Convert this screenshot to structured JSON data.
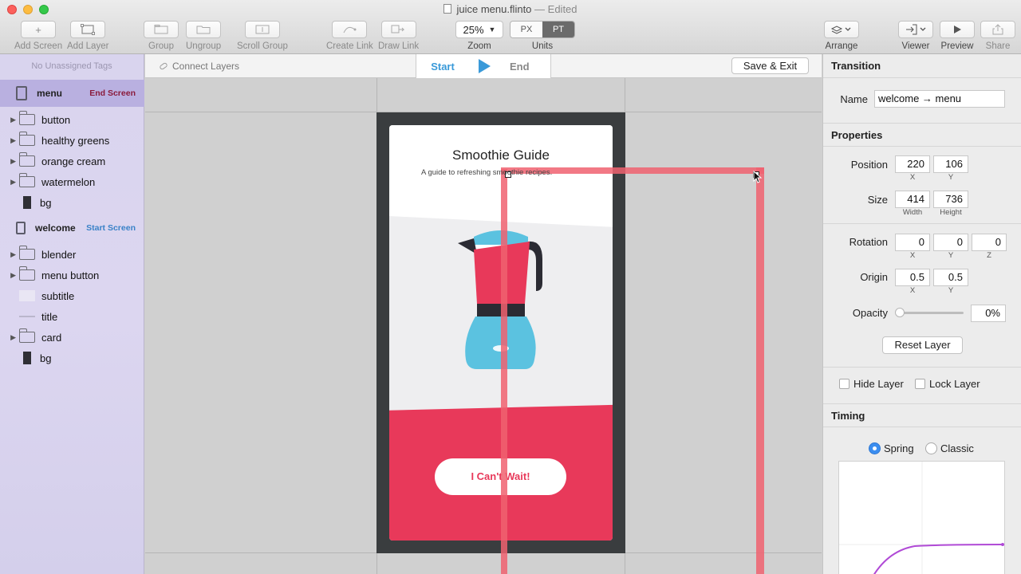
{
  "window": {
    "title": "juice menu.flinto",
    "edited": "— Edited"
  },
  "toolbar": {
    "add_screen": "Add Screen",
    "add_layer": "Add Layer",
    "group": "Group",
    "ungroup": "Ungroup",
    "scroll_group": "Scroll Group",
    "create_link": "Create Link",
    "draw_link": "Draw Link",
    "zoom_value": "25%",
    "zoom_label": "Zoom",
    "units_px": "PX",
    "units_pt": "PT",
    "units_label": "Units",
    "units_selected": "PT",
    "arrange": "Arrange",
    "viewer": "Viewer",
    "preview": "Preview",
    "share": "Share"
  },
  "sidebar": {
    "tags_header": "No Unassigned Tags",
    "screens": [
      {
        "name": "menu",
        "badge": "End Screen",
        "selected": true,
        "layers": [
          {
            "name": "button",
            "type": "folder"
          },
          {
            "name": "healthy greens",
            "type": "folder"
          },
          {
            "name": "orange cream",
            "type": "folder"
          },
          {
            "name": "watermelon",
            "type": "folder"
          },
          {
            "name": "bg",
            "type": "rect"
          }
        ]
      },
      {
        "name": "welcome",
        "badge": "Start Screen",
        "selected": false,
        "layers": [
          {
            "name": "blender",
            "type": "folder"
          },
          {
            "name": "menu button",
            "type": "folder"
          },
          {
            "name": "subtitle",
            "type": "thin"
          },
          {
            "name": "title",
            "type": "line"
          },
          {
            "name": "card",
            "type": "folder"
          },
          {
            "name": "bg",
            "type": "rect"
          }
        ]
      }
    ]
  },
  "canvas": {
    "connect_layers": "Connect Layers",
    "tab_start": "Start",
    "tab_end": "End",
    "save_exit": "Save & Exit",
    "screen": {
      "title": "Smoothie Guide",
      "subtitle": "A guide to refreshing smoothie recipes.",
      "cta": "I Can't Wait!"
    }
  },
  "inspector": {
    "transition_header": "Transition",
    "name_label": "Name",
    "name_value": "welcome → menu",
    "properties_header": "Properties",
    "position_label": "Position",
    "position_x": "220",
    "position_y": "106",
    "size_label": "Size",
    "size_w": "414",
    "size_h": "736",
    "rotation_label": "Rotation",
    "rotation_x": "0",
    "rotation_y": "0",
    "rotation_z": "0",
    "origin_label": "Origin",
    "origin_x": "0.5",
    "origin_y": "0.5",
    "opacity_label": "Opacity",
    "opacity_value": "0%",
    "opacity_fraction": 0,
    "reset_layer": "Reset Layer",
    "hide_layer": "Hide Layer",
    "lock_layer": "Lock Layer",
    "timing_header": "Timing",
    "spring": "Spring",
    "classic": "Classic",
    "timing_selected": "Spring",
    "sub_x": "X",
    "sub_y": "Y",
    "sub_z": "Z",
    "sub_width": "Width",
    "sub_height": "Height"
  },
  "colors": {
    "accent_blue": "#3a9ad9",
    "brand_red": "#e8395a",
    "sidebar_lavender": "#d9d4ee",
    "selection_red": "#f06270",
    "spring_curve": "#b04ad6"
  }
}
